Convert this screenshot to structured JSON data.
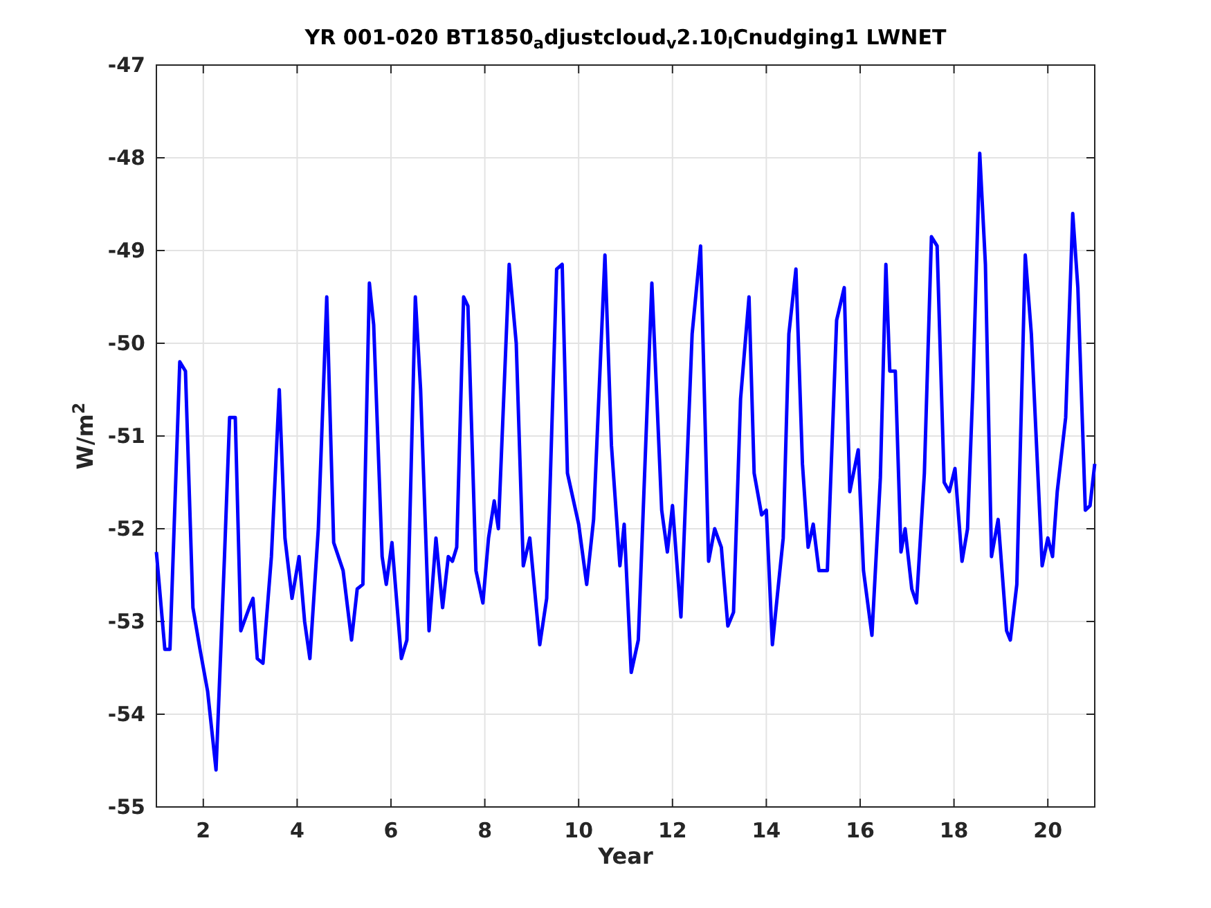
{
  "figure": {
    "chart_data": {
      "type": "line",
      "grid": true,
      "title": "YR 001-020 BT1850$_{a}$djustcloud$_{v}$2.10$_{l}$Cnudging1 LWNET",
      "xlabel": "Year",
      "ylabel": "W/m$^{2}$",
      "xlim": [
        1,
        21
      ],
      "ylim": [
        -55,
        -47
      ],
      "xticks": [
        2,
        4,
        6,
        8,
        10,
        12,
        14,
        16,
        18,
        20
      ],
      "yticks": [
        -55,
        -54,
        -53,
        -52,
        -51,
        -50,
        -49,
        -48,
        -47
      ],
      "x": [
        1.0,
        1.18,
        1.29,
        1.5,
        1.62,
        1.78,
        1.93,
        2.09,
        2.27,
        2.45,
        2.56,
        2.68,
        2.8,
        2.98,
        3.06,
        3.15,
        3.27,
        3.45,
        3.62,
        3.74,
        3.89,
        4.04,
        4.16,
        4.27,
        4.45,
        4.63,
        4.78,
        4.98,
        5.16,
        5.28,
        5.4,
        5.54,
        5.63,
        5.81,
        5.9,
        6.02,
        6.22,
        6.34,
        6.52,
        6.63,
        6.81,
        6.96,
        7.1,
        7.22,
        7.31,
        7.4,
        7.55,
        7.64,
        7.81,
        7.96,
        8.08,
        8.2,
        8.29,
        8.52,
        8.67,
        8.82,
        8.96,
        9.17,
        9.32,
        9.53,
        9.65,
        9.76,
        10.0,
        10.17,
        10.32,
        10.56,
        10.7,
        10.88,
        10.97,
        11.12,
        11.27,
        11.56,
        11.77,
        11.89,
        12.0,
        12.18,
        12.42,
        12.6,
        12.77,
        12.9,
        13.04,
        13.18,
        13.3,
        13.45,
        13.63,
        13.74,
        13.9,
        14.0,
        14.13,
        14.24,
        14.36,
        14.48,
        14.63,
        14.77,
        14.89,
        15.0,
        15.12,
        15.3,
        15.5,
        15.66,
        15.78,
        15.96,
        16.07,
        16.25,
        16.43,
        16.55,
        16.63,
        16.75,
        16.87,
        16.96,
        17.1,
        17.2,
        17.37,
        17.52,
        17.64,
        17.79,
        17.9,
        18.02,
        18.17,
        18.29,
        18.4,
        18.55,
        18.67,
        18.8,
        18.94,
        19.12,
        19.2,
        19.34,
        19.52,
        19.65,
        19.88,
        20.0,
        20.1,
        20.2,
        20.38,
        20.53,
        20.64,
        20.8,
        20.9,
        21.0
      ],
      "series": [
        {
          "color": "#0000ff",
          "values": [
            -52.25,
            -53.3,
            -53.3,
            -50.2,
            -50.3,
            -52.85,
            -53.3,
            -53.75,
            -54.6,
            -52.3,
            -50.8,
            -50.8,
            -53.1,
            -52.85,
            -52.75,
            -53.4,
            -53.45,
            -52.3,
            -50.5,
            -52.1,
            -52.75,
            -52.3,
            -53.0,
            -53.4,
            -52.0,
            -49.5,
            -52.15,
            -52.45,
            -53.2,
            -52.65,
            -52.6,
            -49.35,
            -49.8,
            -52.3,
            -52.6,
            -52.15,
            -53.4,
            -53.2,
            -49.5,
            -50.5,
            -53.1,
            -52.1,
            -52.85,
            -52.3,
            -52.35,
            -52.2,
            -49.5,
            -49.6,
            -52.45,
            -52.8,
            -52.1,
            -51.7,
            -52.0,
            -49.15,
            -50.0,
            -52.4,
            -52.1,
            -53.25,
            -52.75,
            -49.2,
            -49.15,
            -51.4,
            -51.95,
            -52.6,
            -51.9,
            -49.05,
            -51.1,
            -52.4,
            -51.95,
            -53.55,
            -53.2,
            -49.35,
            -51.8,
            -52.25,
            -51.75,
            -52.95,
            -49.9,
            -48.95,
            -52.35,
            -52.0,
            -52.2,
            -53.05,
            -52.9,
            -50.6,
            -49.5,
            -51.4,
            -51.85,
            -51.8,
            -53.25,
            -52.7,
            -52.1,
            -49.9,
            -49.2,
            -51.3,
            -52.2,
            -51.95,
            -52.45,
            -52.45,
            -49.75,
            -49.4,
            -51.6,
            -51.15,
            -52.45,
            -53.15,
            -51.45,
            -49.15,
            -50.3,
            -50.3,
            -52.25,
            -52.0,
            -52.65,
            -52.8,
            -51.4,
            -48.85,
            -48.95,
            -51.5,
            -51.6,
            -51.35,
            -52.35,
            -52.0,
            -50.5,
            -47.95,
            -49.15,
            -52.3,
            -51.9,
            -53.1,
            -53.2,
            -52.6,
            -49.05,
            -49.9,
            -52.4,
            -52.1,
            -52.3,
            -51.6,
            -50.8,
            -48.6,
            -49.4,
            -51.8,
            -51.75,
            -51.3
          ]
        }
      ]
    }
  }
}
